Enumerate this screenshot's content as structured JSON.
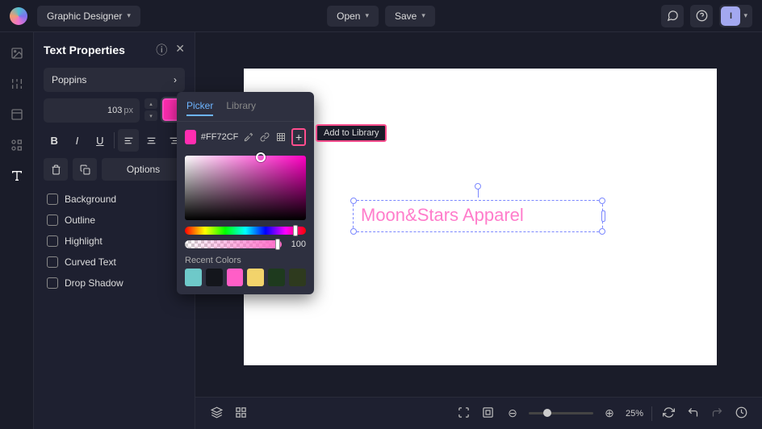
{
  "topbar": {
    "mode": "Graphic Designer",
    "open": "Open",
    "save": "Save",
    "avatar_initial": "I"
  },
  "panel": {
    "title": "Text Properties",
    "font": "Poppins",
    "size_value": "103",
    "size_unit": "px",
    "options_label": "Options",
    "checks": [
      "Background",
      "Outline",
      "Highlight",
      "Curved Text",
      "Drop Shadow"
    ]
  },
  "color_picker": {
    "tabs": {
      "picker": "Picker",
      "library": "Library"
    },
    "hex": "#FF72CF",
    "alpha": "100",
    "add_tooltip": "Add to Library",
    "recent_label": "Recent Colors",
    "recent": [
      "#6ec9c9",
      "#14161c",
      "#ff5ec7",
      "#f2d36b",
      "#1e3a1e",
      "#2e3a1e"
    ]
  },
  "canvas": {
    "text": "Moon&Stars Apparel"
  },
  "bottombar": {
    "zoom": "25%"
  }
}
